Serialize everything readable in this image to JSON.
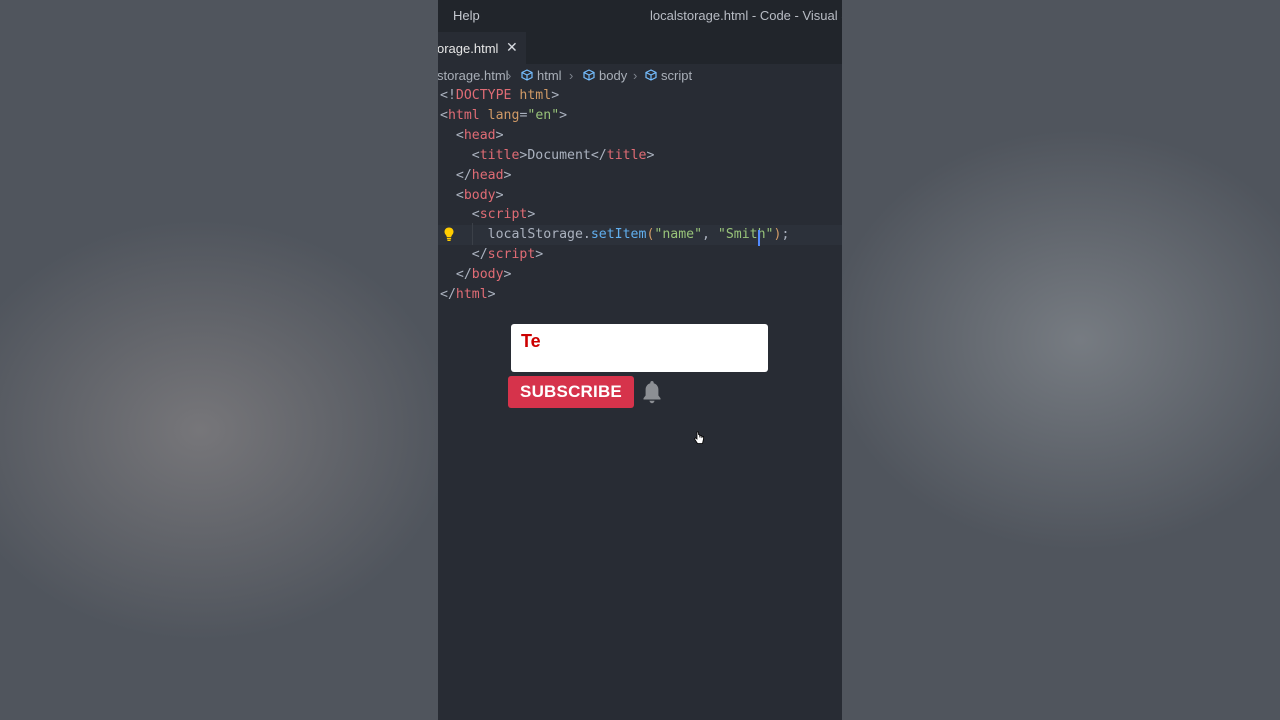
{
  "titlebar": {
    "menu_help": "Help",
    "window_title": "localstorage.html - Code - Visual Stu"
  },
  "tab": {
    "filename": "orage.html",
    "close": "✕"
  },
  "breadcrumb": {
    "file": "storage.html",
    "items": [
      "html",
      "body",
      "script"
    ]
  },
  "code": {
    "lines": [
      [
        {
          "t": "<!",
          "c": "pn"
        },
        {
          "t": "DOCTYPE",
          "c": "tg"
        },
        {
          "t": " ",
          "c": "pn"
        },
        {
          "t": "html",
          "c": "at"
        },
        {
          "t": ">",
          "c": "pn"
        }
      ],
      [
        {
          "t": "<",
          "c": "pn"
        },
        {
          "t": "html",
          "c": "tg"
        },
        {
          "t": " ",
          "c": "pn"
        },
        {
          "t": "lang",
          "c": "at"
        },
        {
          "t": "=",
          "c": "pn"
        },
        {
          "t": "\"en\"",
          "c": "st"
        },
        {
          "t": ">",
          "c": "pn"
        }
      ],
      [
        {
          "t": "  <",
          "c": "pn"
        },
        {
          "t": "head",
          "c": "tg"
        },
        {
          "t": ">",
          "c": "pn"
        }
      ],
      [
        {
          "t": "    <",
          "c": "pn"
        },
        {
          "t": "title",
          "c": "tg"
        },
        {
          "t": ">Document</",
          "c": "pn"
        },
        {
          "t": "title",
          "c": "tg"
        },
        {
          "t": ">",
          "c": "pn"
        }
      ],
      [
        {
          "t": "  </",
          "c": "pn"
        },
        {
          "t": "head",
          "c": "tg"
        },
        {
          "t": ">",
          "c": "pn"
        }
      ],
      [
        {
          "t": "  <",
          "c": "pn"
        },
        {
          "t": "body",
          "c": "tg"
        },
        {
          "t": ">",
          "c": "pn"
        }
      ],
      [
        {
          "t": "    <",
          "c": "pn"
        },
        {
          "t": "script",
          "c": "tg"
        },
        {
          "t": ">",
          "c": "pn"
        }
      ],
      [
        {
          "t": "      localStorage.",
          "c": "pn"
        },
        {
          "t": "setItem",
          "c": "fn"
        },
        {
          "t": "(",
          "c": "at"
        },
        {
          "t": "\"name\"",
          "c": "st"
        },
        {
          "t": ", ",
          "c": "pn"
        },
        {
          "t": "\"Smith\"",
          "c": "st"
        },
        {
          "t": ")",
          "c": "at"
        },
        {
          "t": ";",
          "c": "pn"
        }
      ],
      [
        {
          "t": "    </",
          "c": "pn"
        },
        {
          "t": "script",
          "c": "tg"
        },
        {
          "t": ">",
          "c": "pn"
        }
      ],
      [
        {
          "t": "  </",
          "c": "pn"
        },
        {
          "t": "body",
          "c": "tg"
        },
        {
          "t": ">",
          "c": "pn"
        }
      ],
      [
        {
          "t": "</",
          "c": "pn"
        },
        {
          "t": "html",
          "c": "tg"
        },
        {
          "t": ">",
          "c": "pn"
        }
      ]
    ],
    "active_line": 7
  },
  "overlay": {
    "typing_text": "Te",
    "subscribe_label": "SUBSCRIBE"
  },
  "colors": {
    "editor_bg": "#282c34",
    "subscribe_red": "#d6334b",
    "tag": "#e06c75",
    "string": "#98c379",
    "function": "#61afef"
  }
}
